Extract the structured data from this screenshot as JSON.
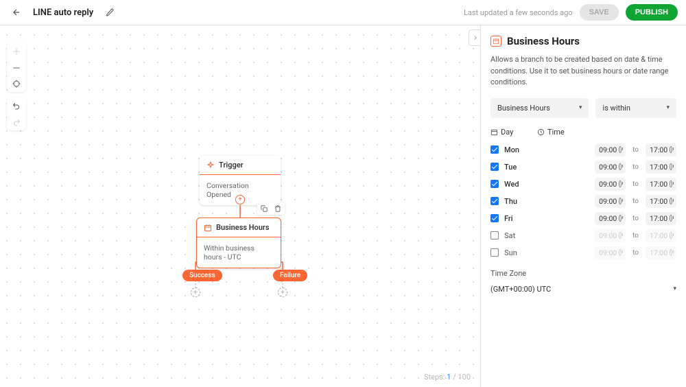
{
  "header": {
    "title": "LINE auto reply",
    "updated": "Last updated a few seconds ago",
    "save": "SAVE",
    "publish": "PUBLISH"
  },
  "canvas": {
    "trigger_label": "Trigger",
    "trigger_body": "Conversation Opened",
    "bh_label": "Business Hours",
    "bh_body": "Within business hours - UTC",
    "success": "Success",
    "failure": "Failure",
    "steps_prefix": "Steps:",
    "steps_current": "1",
    "steps_max": "100"
  },
  "panel": {
    "title": "Business Hours",
    "desc": "Allows a branch to be created based on date & time conditions. Use it to set business hours or date range conditions.",
    "type_select": "Business Hours",
    "cond_select": "is within",
    "day_header": "Day",
    "time_header": "Time",
    "to": "to",
    "days": [
      {
        "label": "Mon",
        "enabled": true,
        "from": "09:00",
        "to": "17:00"
      },
      {
        "label": "Tue",
        "enabled": true,
        "from": "09:00",
        "to": "17:00"
      },
      {
        "label": "Wed",
        "enabled": true,
        "from": "09:00",
        "to": "17:00"
      },
      {
        "label": "Thu",
        "enabled": true,
        "from": "09:00",
        "to": "17:00"
      },
      {
        "label": "Fri",
        "enabled": true,
        "from": "09:00",
        "to": "17:00"
      },
      {
        "label": "Sat",
        "enabled": false,
        "from": "09:00",
        "to": "17:00"
      },
      {
        "label": "Sun",
        "enabled": false,
        "from": "09:00",
        "to": "17:00"
      }
    ],
    "tz_label": "Time Zone",
    "tz_value": "(GMT+00:00) UTC"
  }
}
